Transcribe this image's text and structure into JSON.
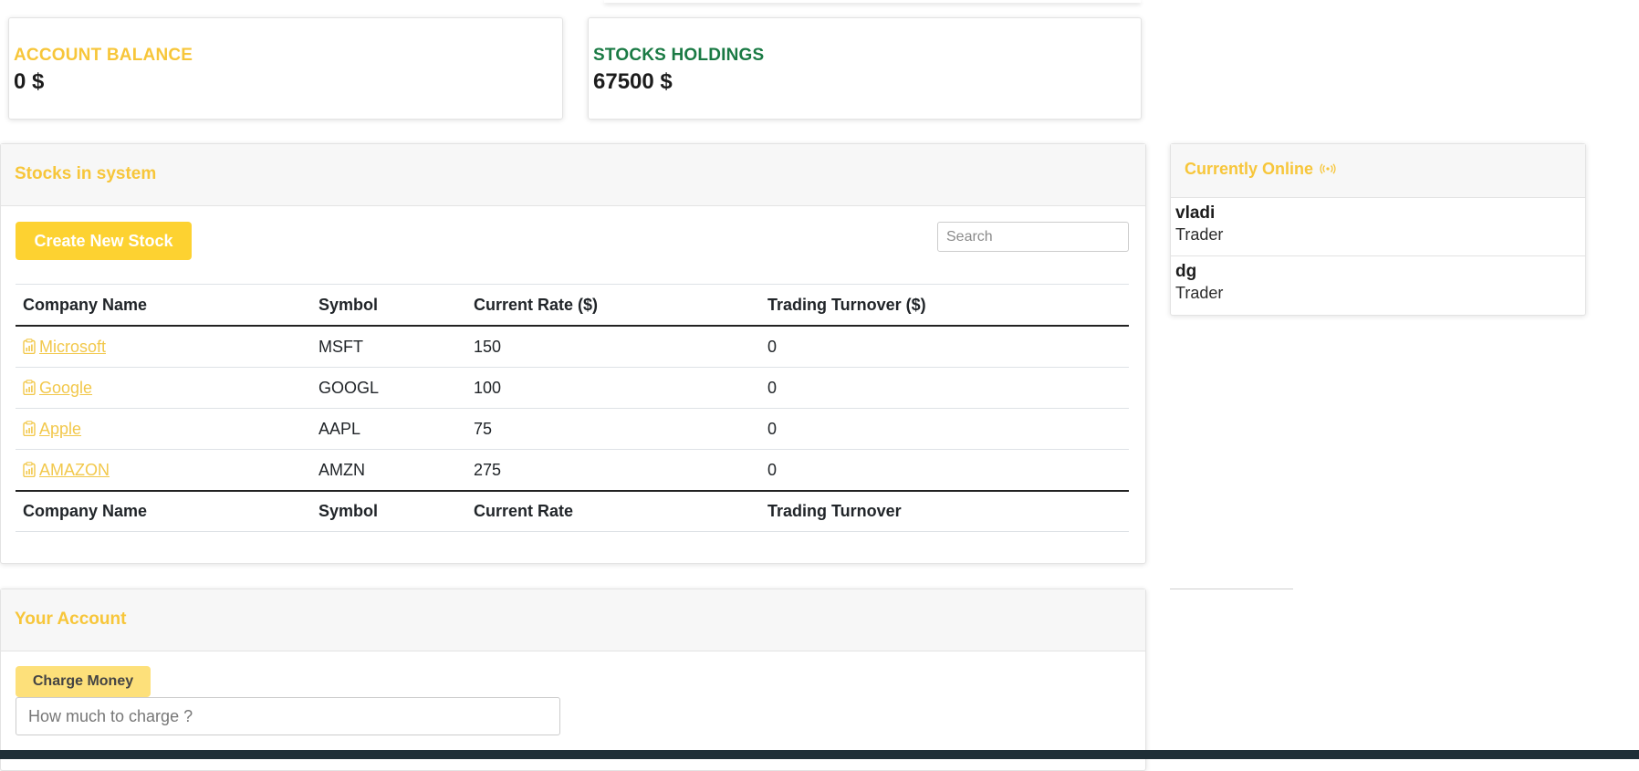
{
  "account_balance": {
    "label": "ACCOUNT BALANCE",
    "value": "0 $",
    "color": "#f7c63a"
  },
  "stocks_holdings": {
    "label": "STOCKS HOLDINGS",
    "value": "67500 $",
    "color": "#1a7a44"
  },
  "stocks_panel": {
    "title": "Stocks in system",
    "create_button": "Create New Stock",
    "search_placeholder": "Search",
    "columns": [
      "Company Name",
      "Symbol",
      "Current Rate ($)",
      "Trading Turnover ($)"
    ],
    "rows": [
      {
        "company": "Microsoft",
        "symbol": "MSFT",
        "rate": "150",
        "turnover": "0"
      },
      {
        "company": "Google",
        "symbol": "GOOGL",
        "rate": "100",
        "turnover": "0"
      },
      {
        "company": "Apple",
        "symbol": "AAPL",
        "rate": "75",
        "turnover": "0"
      },
      {
        "company": "AMAZON",
        "symbol": "AMZN",
        "rate": "275",
        "turnover": "0"
      }
    ],
    "footer_columns": [
      "Company Name",
      "Symbol",
      "Current Rate",
      "Trading Turnover"
    ],
    "row_icon": "clipboard-chart-icon"
  },
  "online_panel": {
    "title": "Currently Online",
    "title_icon": "broadcast-icon",
    "users": [
      {
        "name": "vladi",
        "role": "Trader"
      },
      {
        "name": "dg",
        "role": "Trader"
      }
    ]
  },
  "account_panel": {
    "title": "Your Account",
    "charge_button": "Charge Money",
    "charge_placeholder": "How much to charge ?"
  },
  "colors": {
    "accent": "#f7c63a",
    "button": "#fdd231",
    "holdings": "#1a7a44"
  }
}
